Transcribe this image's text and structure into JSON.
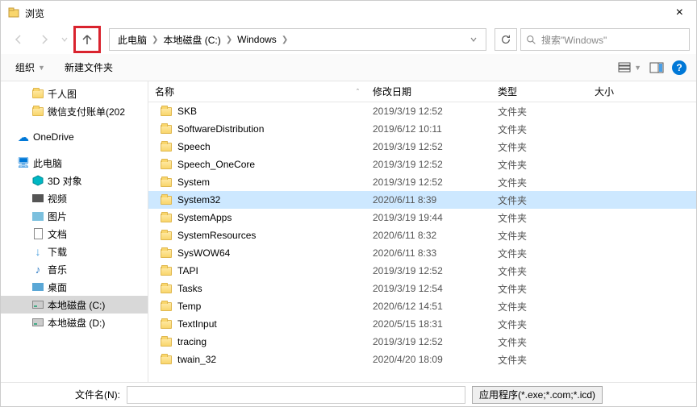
{
  "window": {
    "title": "浏览",
    "close": "×"
  },
  "nav": {
    "breadcrumb": [
      "此电脑",
      "本地磁盘 (C:)",
      "Windows"
    ],
    "search_placeholder": "搜索\"Windows\""
  },
  "toolbar": {
    "organize": "组织",
    "new_folder": "新建文件夹",
    "help": "?"
  },
  "sidebar": {
    "items": [
      {
        "label": "千人图",
        "icon": "folder",
        "indent": true
      },
      {
        "label": "微信支付账单(202",
        "icon": "folder",
        "indent": true
      },
      {
        "label": "OneDrive",
        "icon": "onedrive",
        "indent": false,
        "spaceBefore": true
      },
      {
        "label": "此电脑",
        "icon": "pc",
        "indent": false,
        "spaceBefore": true
      },
      {
        "label": "3D 对象",
        "icon": "obj3d",
        "indent": true
      },
      {
        "label": "视频",
        "icon": "video",
        "indent": true
      },
      {
        "label": "图片",
        "icon": "pic",
        "indent": true
      },
      {
        "label": "文档",
        "icon": "doc",
        "indent": true
      },
      {
        "label": "下载",
        "icon": "down",
        "indent": true
      },
      {
        "label": "音乐",
        "icon": "music",
        "indent": true
      },
      {
        "label": "桌面",
        "icon": "desk",
        "indent": true
      },
      {
        "label": "本地磁盘 (C:)",
        "icon": "disk",
        "indent": true,
        "selected": true
      },
      {
        "label": "本地磁盘 (D:)",
        "icon": "disk",
        "indent": true
      }
    ]
  },
  "columns": {
    "name": "名称",
    "date": "修改日期",
    "type": "类型",
    "size": "大小"
  },
  "files": [
    {
      "name": "SKB",
      "date": "2019/3/19 12:52",
      "type": "文件夹"
    },
    {
      "name": "SoftwareDistribution",
      "date": "2019/6/12 10:11",
      "type": "文件夹"
    },
    {
      "name": "Speech",
      "date": "2019/3/19 12:52",
      "type": "文件夹"
    },
    {
      "name": "Speech_OneCore",
      "date": "2019/3/19 12:52",
      "type": "文件夹"
    },
    {
      "name": "System",
      "date": "2019/3/19 12:52",
      "type": "文件夹"
    },
    {
      "name": "System32",
      "date": "2020/6/11 8:39",
      "type": "文件夹",
      "selected": true
    },
    {
      "name": "SystemApps",
      "date": "2019/3/19 19:44",
      "type": "文件夹"
    },
    {
      "name": "SystemResources",
      "date": "2020/6/11 8:32",
      "type": "文件夹"
    },
    {
      "name": "SysWOW64",
      "date": "2020/6/11 8:33",
      "type": "文件夹"
    },
    {
      "name": "TAPI",
      "date": "2019/3/19 12:52",
      "type": "文件夹"
    },
    {
      "name": "Tasks",
      "date": "2019/3/19 12:54",
      "type": "文件夹"
    },
    {
      "name": "Temp",
      "date": "2020/6/12 14:51",
      "type": "文件夹"
    },
    {
      "name": "TextInput",
      "date": "2020/5/15 18:31",
      "type": "文件夹"
    },
    {
      "name": "tracing",
      "date": "2019/3/19 12:52",
      "type": "文件夹"
    },
    {
      "name": "twain_32",
      "date": "2020/4/20 18:09",
      "type": "文件夹"
    }
  ],
  "bottom": {
    "filename_label": "文件名(N):",
    "apply_label": "应用程序(*.exe;*.com;*.icd)"
  }
}
